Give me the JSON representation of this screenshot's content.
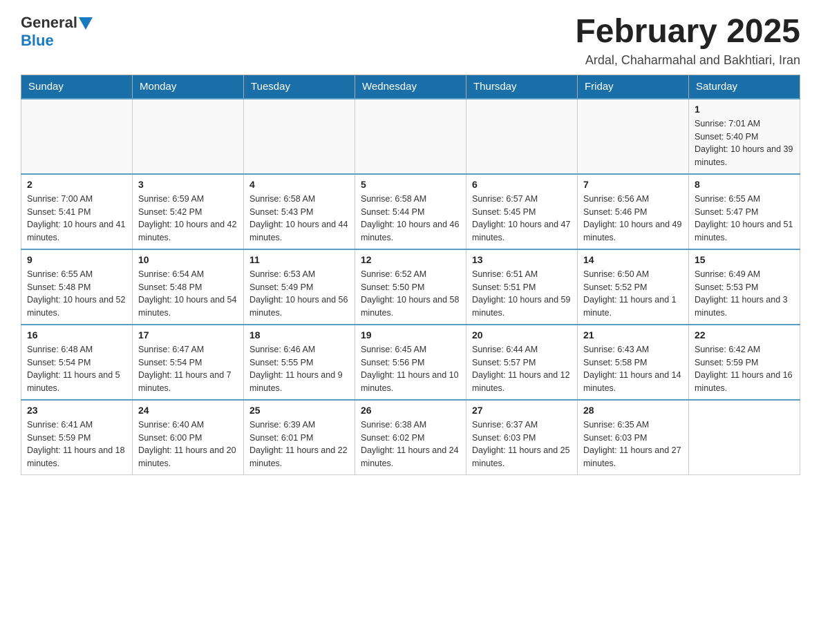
{
  "header": {
    "logo_general": "General",
    "logo_blue": "Blue",
    "month_title": "February 2025",
    "subtitle": "Ardal, Chaharmahal and Bakhtiari, Iran"
  },
  "weekdays": [
    "Sunday",
    "Monday",
    "Tuesday",
    "Wednesday",
    "Thursday",
    "Friday",
    "Saturday"
  ],
  "weeks": [
    [
      {
        "day": "",
        "info": ""
      },
      {
        "day": "",
        "info": ""
      },
      {
        "day": "",
        "info": ""
      },
      {
        "day": "",
        "info": ""
      },
      {
        "day": "",
        "info": ""
      },
      {
        "day": "",
        "info": ""
      },
      {
        "day": "1",
        "info": "Sunrise: 7:01 AM\nSunset: 5:40 PM\nDaylight: 10 hours and 39 minutes."
      }
    ],
    [
      {
        "day": "2",
        "info": "Sunrise: 7:00 AM\nSunset: 5:41 PM\nDaylight: 10 hours and 41 minutes."
      },
      {
        "day": "3",
        "info": "Sunrise: 6:59 AM\nSunset: 5:42 PM\nDaylight: 10 hours and 42 minutes."
      },
      {
        "day": "4",
        "info": "Sunrise: 6:58 AM\nSunset: 5:43 PM\nDaylight: 10 hours and 44 minutes."
      },
      {
        "day": "5",
        "info": "Sunrise: 6:58 AM\nSunset: 5:44 PM\nDaylight: 10 hours and 46 minutes."
      },
      {
        "day": "6",
        "info": "Sunrise: 6:57 AM\nSunset: 5:45 PM\nDaylight: 10 hours and 47 minutes."
      },
      {
        "day": "7",
        "info": "Sunrise: 6:56 AM\nSunset: 5:46 PM\nDaylight: 10 hours and 49 minutes."
      },
      {
        "day": "8",
        "info": "Sunrise: 6:55 AM\nSunset: 5:47 PM\nDaylight: 10 hours and 51 minutes."
      }
    ],
    [
      {
        "day": "9",
        "info": "Sunrise: 6:55 AM\nSunset: 5:48 PM\nDaylight: 10 hours and 52 minutes."
      },
      {
        "day": "10",
        "info": "Sunrise: 6:54 AM\nSunset: 5:48 PM\nDaylight: 10 hours and 54 minutes."
      },
      {
        "day": "11",
        "info": "Sunrise: 6:53 AM\nSunset: 5:49 PM\nDaylight: 10 hours and 56 minutes."
      },
      {
        "day": "12",
        "info": "Sunrise: 6:52 AM\nSunset: 5:50 PM\nDaylight: 10 hours and 58 minutes."
      },
      {
        "day": "13",
        "info": "Sunrise: 6:51 AM\nSunset: 5:51 PM\nDaylight: 10 hours and 59 minutes."
      },
      {
        "day": "14",
        "info": "Sunrise: 6:50 AM\nSunset: 5:52 PM\nDaylight: 11 hours and 1 minute."
      },
      {
        "day": "15",
        "info": "Sunrise: 6:49 AM\nSunset: 5:53 PM\nDaylight: 11 hours and 3 minutes."
      }
    ],
    [
      {
        "day": "16",
        "info": "Sunrise: 6:48 AM\nSunset: 5:54 PM\nDaylight: 11 hours and 5 minutes."
      },
      {
        "day": "17",
        "info": "Sunrise: 6:47 AM\nSunset: 5:54 PM\nDaylight: 11 hours and 7 minutes."
      },
      {
        "day": "18",
        "info": "Sunrise: 6:46 AM\nSunset: 5:55 PM\nDaylight: 11 hours and 9 minutes."
      },
      {
        "day": "19",
        "info": "Sunrise: 6:45 AM\nSunset: 5:56 PM\nDaylight: 11 hours and 10 minutes."
      },
      {
        "day": "20",
        "info": "Sunrise: 6:44 AM\nSunset: 5:57 PM\nDaylight: 11 hours and 12 minutes."
      },
      {
        "day": "21",
        "info": "Sunrise: 6:43 AM\nSunset: 5:58 PM\nDaylight: 11 hours and 14 minutes."
      },
      {
        "day": "22",
        "info": "Sunrise: 6:42 AM\nSunset: 5:59 PM\nDaylight: 11 hours and 16 minutes."
      }
    ],
    [
      {
        "day": "23",
        "info": "Sunrise: 6:41 AM\nSunset: 5:59 PM\nDaylight: 11 hours and 18 minutes."
      },
      {
        "day": "24",
        "info": "Sunrise: 6:40 AM\nSunset: 6:00 PM\nDaylight: 11 hours and 20 minutes."
      },
      {
        "day": "25",
        "info": "Sunrise: 6:39 AM\nSunset: 6:01 PM\nDaylight: 11 hours and 22 minutes."
      },
      {
        "day": "26",
        "info": "Sunrise: 6:38 AM\nSunset: 6:02 PM\nDaylight: 11 hours and 24 minutes."
      },
      {
        "day": "27",
        "info": "Sunrise: 6:37 AM\nSunset: 6:03 PM\nDaylight: 11 hours and 25 minutes."
      },
      {
        "day": "28",
        "info": "Sunrise: 6:35 AM\nSunset: 6:03 PM\nDaylight: 11 hours and 27 minutes."
      },
      {
        "day": "",
        "info": ""
      }
    ]
  ]
}
